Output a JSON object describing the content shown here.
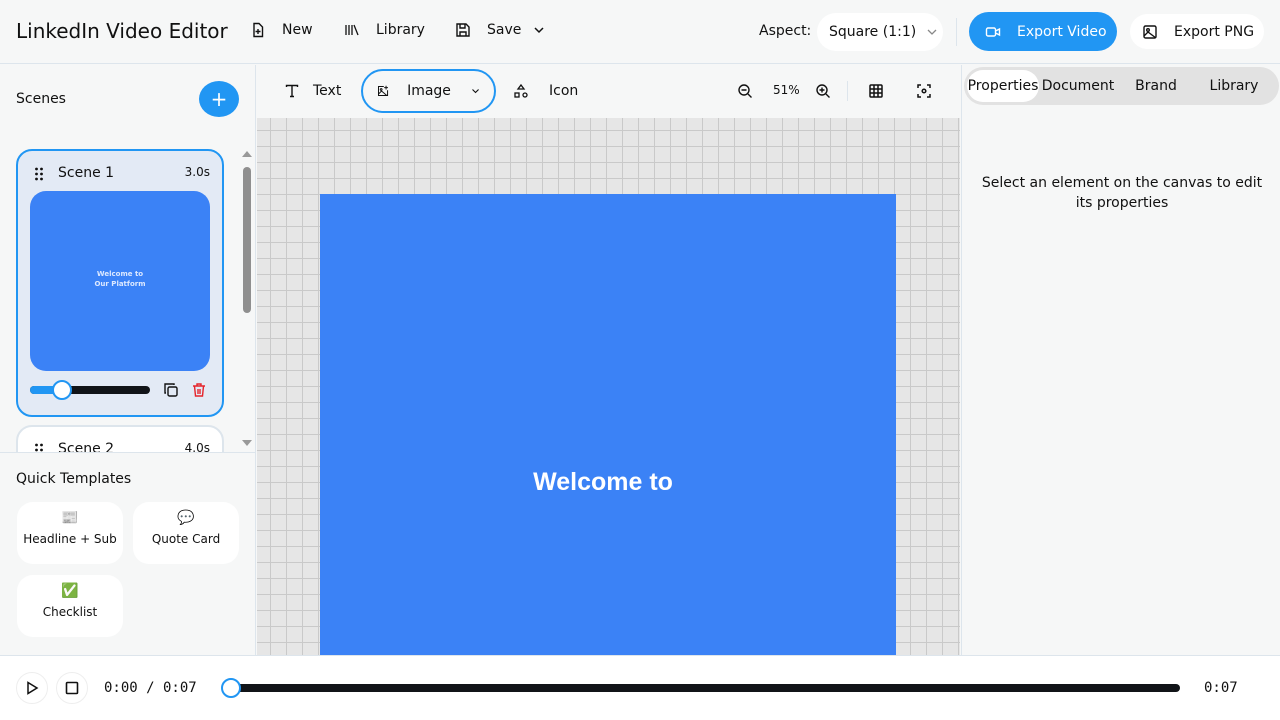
{
  "header": {
    "title": "LinkedIn Video Editor",
    "new_label": "New",
    "library_label": "Library",
    "save_label": "Save",
    "aspect_label": "Aspect:",
    "aspect_value": "Square (1:1)",
    "export_video": "Export Video",
    "export_png": "Export PNG"
  },
  "scenes": {
    "heading": "Scenes",
    "items": [
      {
        "name": "Scene 1",
        "duration": "3.0s",
        "preview_line1": "Welcome to",
        "preview_line2": "Our Platform",
        "slider_fraction": 0.27
      },
      {
        "name": "Scene 2",
        "duration": "4.0s"
      }
    ]
  },
  "templates": {
    "heading": "Quick Templates",
    "items": [
      {
        "emoji": "📰",
        "label": "Headline + Sub"
      },
      {
        "emoji": "💬",
        "label": "Quote Card"
      },
      {
        "emoji": "✅",
        "label": "Checklist"
      }
    ]
  },
  "toolbar": {
    "text": "Text",
    "image": "Image",
    "icon": "Icon",
    "zoom": "51%"
  },
  "canvas": {
    "text": "Welcome to",
    "bg": "#3b82f6"
  },
  "panel": {
    "tabs": [
      "Properties",
      "Document",
      "Brand",
      "Library"
    ],
    "hint": "Select an element on the canvas to edit its properties"
  },
  "playback": {
    "current": "0:00 / 0:07",
    "end": "0:07",
    "progress": 0
  }
}
